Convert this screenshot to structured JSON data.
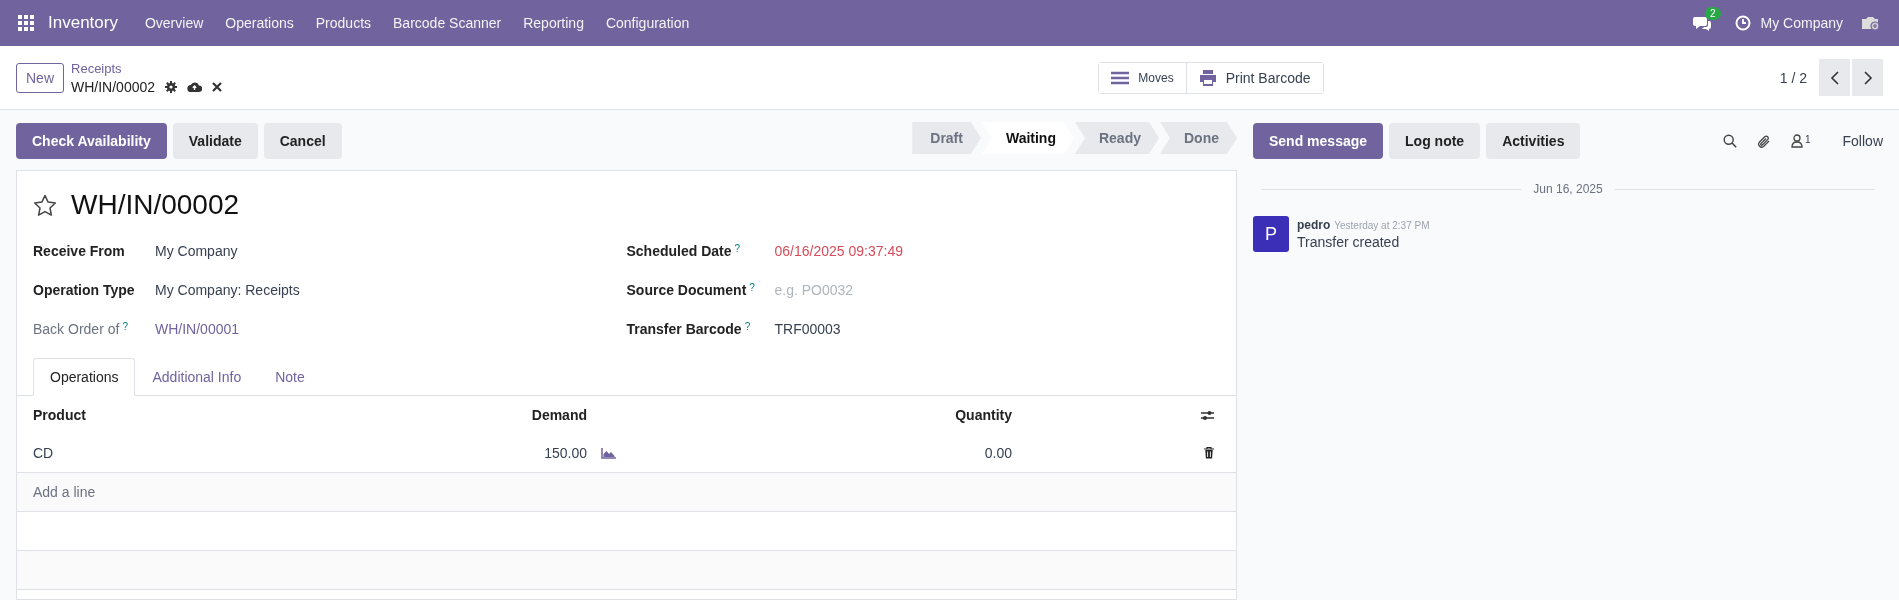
{
  "navbar": {
    "app_name": "Inventory",
    "menu": [
      "Overview",
      "Operations",
      "Products",
      "Barcode Scanner",
      "Reporting",
      "Configuration"
    ],
    "messages_badge": "2",
    "company": "My Company"
  },
  "control_panel": {
    "new_button": "New",
    "breadcrumb": "Receipts",
    "record_name": "WH/IN/00002",
    "moves_button": "Moves",
    "print_button": "Print Barcode",
    "pager": "1 / 2"
  },
  "actions": [
    {
      "label": "Check Availability",
      "primary": true
    },
    {
      "label": "Validate",
      "primary": false
    },
    {
      "label": "Cancel",
      "primary": false
    }
  ],
  "status_stages": [
    {
      "label": "Draft",
      "selected": false
    },
    {
      "label": "Waiting",
      "selected": true
    },
    {
      "label": "Ready",
      "selected": false
    },
    {
      "label": "Done",
      "selected": false
    }
  ],
  "form": {
    "title": "WH/IN/00002",
    "starred": false,
    "left_fields": [
      {
        "label": "Receive From",
        "muted": false,
        "value": "My Company",
        "kind": "text"
      },
      {
        "label": "Operation Type",
        "muted": false,
        "value": "My Company: Receipts",
        "kind": "text"
      },
      {
        "label": "Back Order of",
        "help": "?",
        "muted": true,
        "value": "WH/IN/00001",
        "kind": "link"
      }
    ],
    "right_fields": [
      {
        "label": "Scheduled Date",
        "help": "?",
        "muted": false,
        "value": "06/16/2025 09:37:49",
        "kind": "overdue"
      },
      {
        "label": "Source Document",
        "help": "?",
        "muted": false,
        "placeholder": "e.g. PO0032",
        "kind": "placeholder"
      },
      {
        "label": "Transfer Barcode",
        "help": "?",
        "muted": false,
        "value": "TRF00003",
        "kind": "text"
      }
    ],
    "tabs": [
      {
        "label": "Operations",
        "selected": true
      },
      {
        "label": "Additional Info",
        "selected": false
      },
      {
        "label": "Note",
        "selected": false
      }
    ],
    "table": {
      "columns": [
        "Product",
        "Demand",
        "Quantity"
      ],
      "rows": [
        {
          "product": "CD",
          "demand": "150.00",
          "quantity": "0.00"
        }
      ],
      "add_line": "Add a line"
    }
  },
  "chatter": {
    "buttons": [
      {
        "label": "Send message",
        "primary": true
      },
      {
        "label": "Log note",
        "primary": false
      },
      {
        "label": "Activities",
        "primary": false
      }
    ],
    "followers_count": "1",
    "follow": "Follow",
    "date": "Jun 16, 2025",
    "messages": [
      {
        "avatar": "P",
        "author": "pedro",
        "time": "Yesterday at 2:37 PM",
        "body": "Transfer created"
      }
    ]
  }
}
